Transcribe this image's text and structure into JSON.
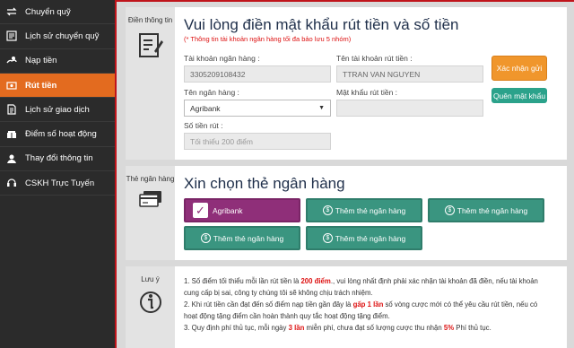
{
  "sidebar": {
    "items": [
      {
        "label": "Chuyển quỹ",
        "icon": "transfer-icon"
      },
      {
        "label": "Lịch sử chuyển quỹ",
        "icon": "history-icon"
      },
      {
        "label": "Nạp tiền",
        "icon": "deposit-icon"
      },
      {
        "label": "Rút tiền",
        "icon": "withdraw-icon",
        "active": true
      },
      {
        "label": "Lịch sử giao dịch",
        "icon": "document-icon"
      },
      {
        "label": "Điểm số hoạt động",
        "icon": "score-icon"
      },
      {
        "label": "Thay đổi thông tin",
        "icon": "user-icon"
      },
      {
        "label": "CSKH Trực Tuyến",
        "icon": "support-icon"
      }
    ]
  },
  "info_section": {
    "side_label": "Điền thông tin",
    "title": "Vui lòng điền mật khẩu rút tiền và số tiền",
    "note": "(* Thông tin tài khoản ngân hàng tối đa bảo lưu 5 nhóm)",
    "account_number_label": "Tài khoản ngân hàng :",
    "account_number_value": "3305209108432",
    "account_name_label": "Tên tài khoản rút tiền :",
    "account_name_value": "TTRAN VAN NGUYEN",
    "bank_name_label": "Tên ngân hàng :",
    "bank_name_value": "Agribank",
    "password_label": "Mật khẩu rút tiền :",
    "password_value": "",
    "amount_label": "Số tiền rút :",
    "amount_placeholder": "Tối thiểu 200 điểm",
    "confirm_button": "Xác nhận gửi",
    "forgot_button": "Quên mật khẩu"
  },
  "bank_section": {
    "side_label": "Thẻ ngân hàng",
    "title": "Xin chọn thẻ ngân hàng",
    "selected_bank": "Agribank",
    "add_bank_label": "Thêm thẻ ngân hàng"
  },
  "notes_section": {
    "side_label": "Lưu ý",
    "line1_a": "1. Số điểm tối thiểu mỗi lần rút tiền là ",
    "line1_b": "200 điểm",
    "line1_c": "., vui lòng nhất định phải xác nhận tài khoản đã điền, nếu tài khoản",
    "line2": "cung cấp bị sai, công ty chúng tôi sẽ không chịu trách nhiệm.",
    "line3_a": "2. Khi rút tiền cần đạt đến số điểm nạp tiền gần đây là ",
    "line3_b": "gấp 1 lần",
    "line3_c": " số vòng cược mới có thể yêu cầu rút tiền, nếu có",
    "line4": "hoạt động tặng điểm cần hoàn thành quy tắc hoạt động tặng điểm.",
    "line5_a": "3. Quy định phí thủ tục, mỗi ngày ",
    "line5_b": "3 lần",
    "line5_c": " miễn phí, chưa đạt số lượng cược thu nhận ",
    "line5_d": "5%",
    "line5_e": " Phí thủ tục."
  },
  "colors": {
    "sidebar_bg": "#2b2b2b",
    "active": "#e36b1f",
    "accent_red": "#c0141b",
    "teal": "#3a9580",
    "purple": "#8f2f79",
    "orange": "#f0962c"
  }
}
